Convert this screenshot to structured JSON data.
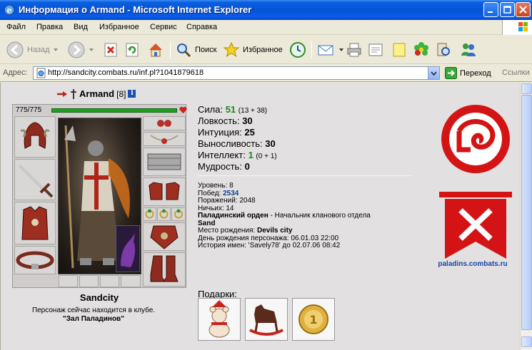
{
  "window": {
    "title": "Информация о Armand - Microsoft Internet Explorer"
  },
  "menu": [
    "Файл",
    "Правка",
    "Вид",
    "Избранное",
    "Сервис",
    "Справка"
  ],
  "toolbar": {
    "back": "Назад",
    "search": "Поиск",
    "favorites": "Избранное"
  },
  "address": {
    "label": "Адрес:",
    "url": "http://sandcity.combats.ru/inf.pl?1041879618",
    "go": "Переход",
    "links": "Ссылки"
  },
  "character": {
    "name": "Armand",
    "level": "[8]",
    "hp": "775/775",
    "hp_fraction": 1.0,
    "city": "Sandcity",
    "club_text": "Персонаж сейчас находится в клубе.",
    "club_room": "\"Зал Паладинов\""
  },
  "stats": [
    {
      "label": "Сила:",
      "value": "51",
      "extra": "(13 + 38)",
      "green": true
    },
    {
      "label": "Ловкость:",
      "value": "30",
      "extra": "",
      "green": false
    },
    {
      "label": "Интуиция:",
      "value": "25",
      "extra": "",
      "green": false
    },
    {
      "label": "Выносливость:",
      "value": "30",
      "extra": "",
      "green": false
    },
    {
      "label": "Интеллект:",
      "value": "1",
      "extra": "(0 + 1)",
      "green": true
    },
    {
      "label": "Мудрость:",
      "value": "0",
      "extra": "",
      "green": false
    }
  ],
  "details": {
    "level": "Уровень: 8",
    "wins_label": "Побед:",
    "wins": "2534",
    "losses": "Поражений: 2048",
    "draws": "Ничьих: 14",
    "order": "Паладинский орден",
    "order_rank": " - Начальник кланового отдела",
    "order_sub": "Sand",
    "birthplace_label": "Место рождения:",
    "birthplace": "Devils city",
    "birthday": "День рождения персонажа: 06.01.03 22:00",
    "name_history": "История имен: 'Savely78' до 02.07.06 08:42"
  },
  "gifts": {
    "label": "Подарки:"
  },
  "clan": {
    "site": "paladins.combats.ru"
  }
}
